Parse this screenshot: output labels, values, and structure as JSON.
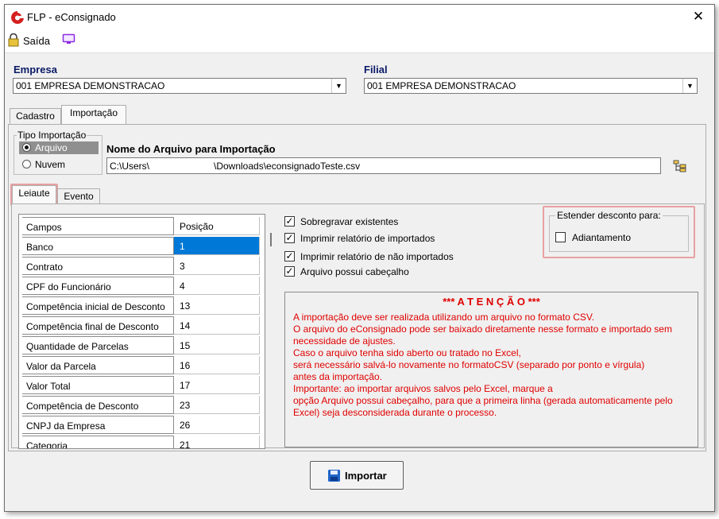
{
  "window": {
    "title": "FLP - eConsignado",
    "close_label": "✕"
  },
  "toolbar": {
    "exit_label": "Saída"
  },
  "empresa": {
    "label": "Empresa",
    "value": "001 EMPRESA DEMONSTRACAO"
  },
  "filial": {
    "label": "Filial",
    "value": "001 EMPRESA DEMONSTRACAO"
  },
  "main_tabs": [
    {
      "label": "Cadastro"
    },
    {
      "label": "Importação"
    }
  ],
  "tipo_importacao": {
    "label": "Tipo Importação",
    "options": [
      {
        "label": "Arquivo",
        "selected": true
      },
      {
        "label": "Nuvem",
        "selected": false
      }
    ]
  },
  "arquivo": {
    "label": "Nome do Arquivo para Importação",
    "path_prefix": "C:\\Users\\",
    "path_suffix": "\\Downloads\\econsignadoTeste.csv"
  },
  "sub_tabs": [
    {
      "label": "Leiaute"
    },
    {
      "label": "Evento"
    }
  ],
  "grid": {
    "headers": [
      "Campos",
      "Posição"
    ],
    "rows": [
      {
        "campo": "Banco",
        "posicao": "1"
      },
      {
        "campo": "Contrato",
        "posicao": "3"
      },
      {
        "campo": "CPF do Funcionário",
        "posicao": "4"
      },
      {
        "campo": "Competência inicial de Desconto",
        "posicao": "13"
      },
      {
        "campo": "Competência final de Desconto",
        "posicao": "14"
      },
      {
        "campo": "Quantidade de Parcelas",
        "posicao": "15"
      },
      {
        "campo": "Valor da Parcela",
        "posicao": "16"
      },
      {
        "campo": "Valor Total",
        "posicao": "17"
      },
      {
        "campo": "Competência de Desconto",
        "posicao": "23"
      },
      {
        "campo": "CNPJ da Empresa",
        "posicao": "26"
      },
      {
        "campo": "Categoria",
        "posicao": "21"
      }
    ]
  },
  "options": [
    {
      "label": "Sobregravar existentes",
      "checked": true
    },
    {
      "label": "Imprimir relatório de importados",
      "checked": true
    },
    {
      "label": "Imprimir relatório de não importados",
      "checked": true
    },
    {
      "label": "Arquivo possui cabeçalho",
      "checked": true
    }
  ],
  "estender": {
    "label": "Estender desconto para:",
    "option": "Adiantamento",
    "checked": false
  },
  "atencao": {
    "title": "*** A T E N Ç Ã O ***",
    "lines": [
      "A importação deve ser realizada utilizando um arquivo no formato CSV.",
      "O arquivo do eConsignado pode ser baixado diretamente nesse formato e importado sem",
      "necessidade de ajustes.",
      "Caso o arquivo tenha sido aberto ou tratado no Excel,",
      "será necessário salvá-lo novamente no formatoCSV (separado por ponto e vírgula)",
      "antes da importação.",
      "Importante: ao importar arquivos salvos pelo Excel, marque a",
      "opção Arquivo possui cabeçalho, para que a primeira linha (gerada automaticamente pelo",
      "Excel) seja desconsiderada durante o processo."
    ]
  },
  "import_button": {
    "label": "Importar"
  },
  "colors": {
    "accent": "#0078d7",
    "alert_text": "#e00000",
    "highlight": "#e8a0a0",
    "label_blue": "#0a1a66"
  }
}
